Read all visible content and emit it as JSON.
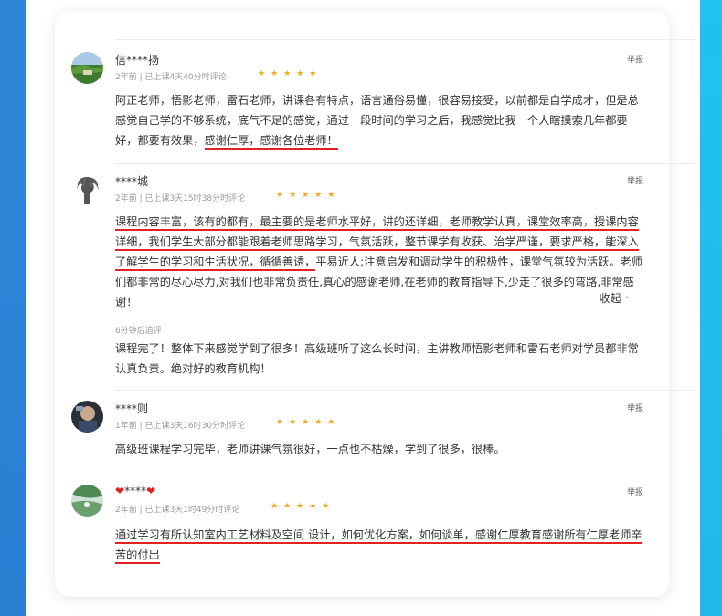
{
  "reviews": [
    {
      "user": "信****扬",
      "meta": "2年前 | 已上课4天40分时评论",
      "stars": "★★★★★",
      "report": "举报",
      "text_plain": "阿正老师，悟影老师，雷石老师，讲课各有特点，语言通俗易懂，很容易接受，以前都是自学成才，但是总感觉自己学的不够系统，底气不足的感觉，通过一段时间的学习之后，我感觉比我一个人瞎摸索几年都要好，都要有效果，",
      "text_underlined": "感谢仁厚，感谢各位老师！"
    },
    {
      "user": "****城",
      "meta": "2年前 | 已上课3天15时38分时评论",
      "stars": "★★★★★",
      "report": "举报",
      "text_underlined": "课程内容丰富，该有的都有，最主要的是老师水平好，讲的还详细，老师教学认真，课堂效率高，授课内容详细，我们学生大部分都能跟着老师思路学习，气氛活跃，整节课学有收获、治学严谨，要求严格，能深入了解学生的学习和生活状况，循循善诱，",
      "text_plain": "平易近人;注意启发和调动学生的积极性，课堂气氛较为活跃。老师们都非常的尽心尽力,对我们也非常负责任,真心的感谢老师,在老师的教育指导下,少走了很多的弯路,非常感谢！",
      "collapse": "收起",
      "followup_label": "6分钟后追评",
      "followup_text": "课程完了！整体下来感觉学到了很多！高级班听了这么长时间，主讲教师悟影老师和雷石老师对学员都非常认真负责。绝对好的教育机构！"
    },
    {
      "user": "****则",
      "meta": "1年前 | 已上课3天16时30分时评论",
      "stars": "★★★★★",
      "report": "举报",
      "text_plain": "高级班课程学习完毕，老师讲课气氛很好，一点也不枯燥，学到了很多，很棒。"
    },
    {
      "user": "****",
      "meta": "2年前 | 已上课3天1时49分时评论",
      "stars": "★★★★★",
      "report": "举报",
      "text_underlined": "通过学习有所认知室内工艺材料及空间 设计，如何优化方案，如何谈单，感谢仁厚教育感谢所有仁厚老师辛苦的付出"
    }
  ]
}
